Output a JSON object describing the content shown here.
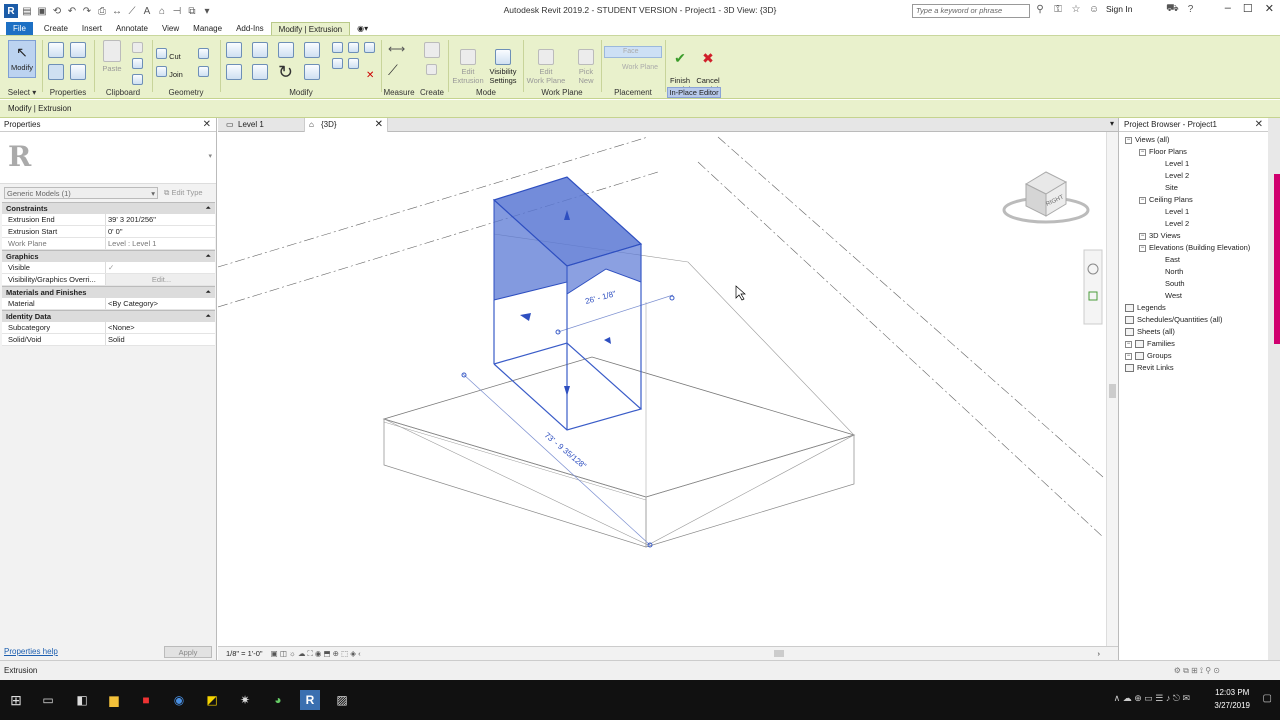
{
  "window": {
    "title": "Autodesk Revit 2019.2 - STUDENT VERSION - Project1 - 3D View: {3D}",
    "search_placeholder": "Type a keyword or phrase",
    "sign_in": "Sign In"
  },
  "menu": {
    "file": "File",
    "tabs": [
      "Create",
      "Insert",
      "Annotate",
      "View",
      "Manage",
      "Add-Ins",
      "Modify | Extrusion"
    ]
  },
  "ribbon": {
    "select": {
      "modify": "Modify",
      "select_label": "Select"
    },
    "properties_label": "Properties",
    "clipboard": {
      "paste": "Paste",
      "label": "Clipboard"
    },
    "geometry": {
      "cut": "Cut",
      "join": "Join",
      "label": "Geometry"
    },
    "modify_label": "Modify",
    "measure_label": "Measure",
    "create_label": "Create",
    "mode": {
      "edit_extrusion": "Edit\nExtrusion",
      "visibility_settings": "Visibility\nSettings",
      "label": "Mode"
    },
    "work_plane": {
      "edit_work_plane": "Edit\nWork Plane",
      "pick_new": "Pick\nNew",
      "label": "Work Plane"
    },
    "placement": {
      "face": "Face",
      "work_plane": "Work Plane",
      "label": "Placement"
    },
    "inplace": {
      "finish": "Finish\nModel",
      "cancel": "Cancel\nModel",
      "label": "In-Place Editor"
    }
  },
  "options_bar": "Modify | Extrusion",
  "properties": {
    "title": "Properties",
    "type_selector": "Generic Models (1)",
    "edit_type": "Edit Type",
    "sections": [
      {
        "name": "Constraints",
        "rows": [
          {
            "k": "Extrusion End",
            "v": "39'  3 201/256\""
          },
          {
            "k": "Extrusion Start",
            "v": "0'  0\""
          },
          {
            "k": "Work Plane",
            "v": "Level : Level 1"
          }
        ]
      },
      {
        "name": "Graphics",
        "rows": [
          {
            "k": "Visible",
            "v": "✓"
          },
          {
            "k": "Visibility/Graphics Overri...",
            "v": "Edit..."
          }
        ]
      },
      {
        "name": "Materials and Finishes",
        "rows": [
          {
            "k": "Material",
            "v": "<By Category>"
          }
        ]
      },
      {
        "name": "Identity Data",
        "rows": [
          {
            "k": "Subcategory",
            "v": "<None>"
          },
          {
            "k": "Solid/Void",
            "v": "Solid"
          }
        ]
      }
    ],
    "help": "Properties help",
    "apply": "Apply"
  },
  "view_tabs": [
    {
      "label": "Level 1"
    },
    {
      "label": "{3D}"
    }
  ],
  "viewport": {
    "dim_top": "26' - 1/8\"",
    "dim_bottom": "73' - 9 35/128\"",
    "viewcube_face": "RIGHT",
    "scale": "1/8\" = 1'-0\""
  },
  "browser": {
    "title": "Project Browser - Project1",
    "items": [
      {
        "label": "Views (all)",
        "level": 1,
        "type": "toggle"
      },
      {
        "label": "Floor Plans",
        "level": 2,
        "type": "toggle"
      },
      {
        "label": "Level 1",
        "level": 3,
        "type": "leaf"
      },
      {
        "label": "Level 2",
        "level": 3,
        "type": "leaf"
      },
      {
        "label": "Site",
        "level": 3,
        "type": "leaf"
      },
      {
        "label": "Ceiling Plans",
        "level": 2,
        "type": "toggle"
      },
      {
        "label": "Level 1",
        "level": 3,
        "type": "leaf"
      },
      {
        "label": "Level 2",
        "level": 3,
        "type": "leaf"
      },
      {
        "label": "3D Views",
        "level": 2,
        "type": "toggle"
      },
      {
        "label": "Elevations (Building Elevation)",
        "level": 2,
        "type": "toggle"
      },
      {
        "label": "East",
        "level": 3,
        "type": "leaf"
      },
      {
        "label": "North",
        "level": 3,
        "type": "leaf"
      },
      {
        "label": "South",
        "level": 3,
        "type": "leaf"
      },
      {
        "label": "West",
        "level": 3,
        "type": "leaf"
      },
      {
        "label": "Legends",
        "level": 1,
        "type": "icon"
      },
      {
        "label": "Schedules/Quantities (all)",
        "level": 1,
        "type": "icon"
      },
      {
        "label": "Sheets (all)",
        "level": 1,
        "type": "icon"
      },
      {
        "label": "Families",
        "level": 1,
        "type": "icon-toggle"
      },
      {
        "label": "Groups",
        "level": 1,
        "type": "icon-toggle"
      },
      {
        "label": "Revit Links",
        "level": 1,
        "type": "icon"
      }
    ]
  },
  "status": "Extrusion",
  "taskbar": {
    "time": "12:03 PM",
    "date": "3/27/2019"
  },
  "colors": {
    "accent": "#1d70c4",
    "ribbon": "#e9f1cc",
    "selection": "#3a5cc8"
  }
}
